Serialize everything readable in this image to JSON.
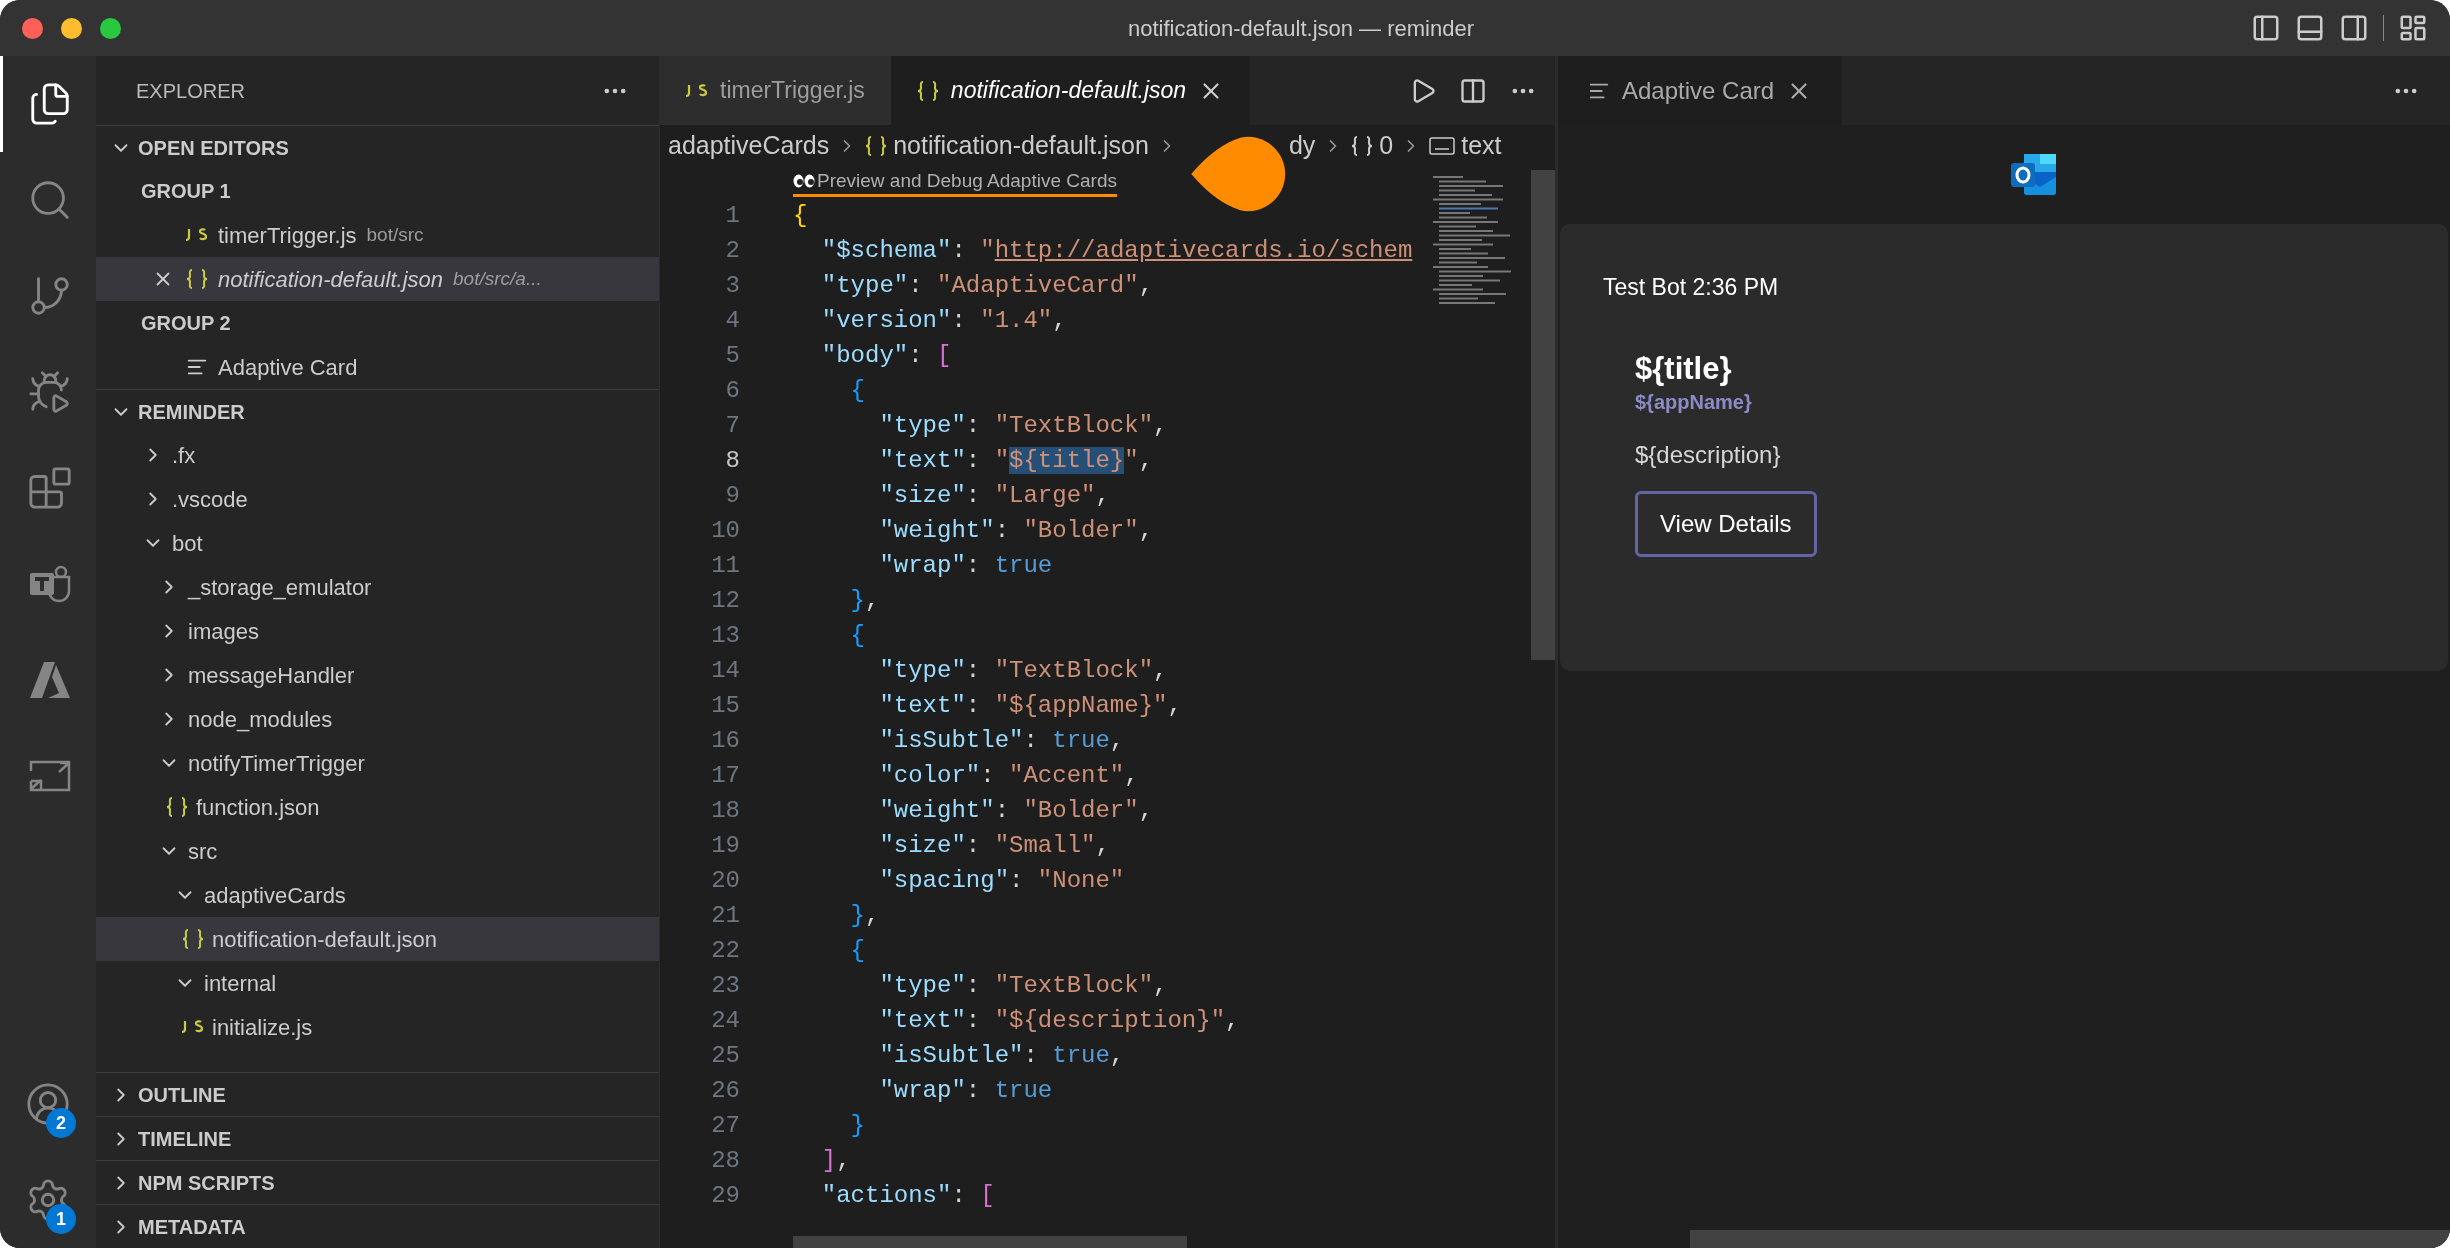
{
  "window": {
    "title": "notification-default.json — reminder"
  },
  "activity_bar": [
    {
      "kind": "explorer",
      "selected": true
    },
    {
      "kind": "search",
      "selected": false
    },
    {
      "kind": "source-control",
      "selected": false
    },
    {
      "kind": "run-debug",
      "selected": false
    },
    {
      "kind": "extensions",
      "selected": false
    },
    {
      "kind": "teams",
      "selected": false
    },
    {
      "kind": "azure",
      "selected": false
    },
    {
      "kind": "remote",
      "selected": false
    }
  ],
  "activity_bar_bottom": [
    {
      "kind": "account",
      "badge": "2"
    },
    {
      "kind": "settings",
      "badge": "1"
    }
  ],
  "sidebar": {
    "title": "EXPLORER",
    "open_editors": {
      "title": "OPEN EDITORS",
      "expanded": true,
      "groups": [
        {
          "title": "GROUP 1",
          "items": [
            {
              "kind": "js",
              "name": "timerTrigger.js",
              "path": "bot/src",
              "selected": false,
              "preview": false
            },
            {
              "kind": "json",
              "name": "notification-default.json",
              "path": "bot/src/a...",
              "selected": true,
              "preview": true
            }
          ]
        },
        {
          "title": "GROUP 2",
          "items": [
            {
              "kind": "preview",
              "name": "Adaptive Card",
              "selected": false,
              "preview": false
            }
          ]
        }
      ]
    },
    "folder": {
      "title": "REMINDER",
      "expanded": true,
      "items": [
        {
          "kind": "folder",
          "name": ".fx",
          "expanded": false,
          "selected": false
        },
        {
          "kind": "folder",
          "name": ".vscode",
          "expanded": false,
          "selected": false
        },
        {
          "kind": "folder",
          "name": "bot",
          "expanded": true,
          "selected": false,
          "children": [
            {
              "kind": "folder",
              "name": "_storage_emulator",
              "expanded": false,
              "selected": false
            },
            {
              "kind": "folder",
              "name": "images",
              "expanded": false,
              "selected": false
            },
            {
              "kind": "folder",
              "name": "messageHandler",
              "expanded": false,
              "selected": false
            },
            {
              "kind": "folder",
              "name": "node_modules",
              "expanded": false,
              "selected": false
            },
            {
              "kind": "folder",
              "name": "notifyTimerTrigger",
              "expanded": true,
              "selected": false,
              "children": [
                {
                  "kind": "json",
                  "name": "function.json",
                  "selected": false
                }
              ]
            },
            {
              "kind": "folder",
              "name": "src",
              "expanded": true,
              "selected": false,
              "children": [
                {
                  "kind": "folder",
                  "name": "adaptiveCards",
                  "expanded": true,
                  "selected": false,
                  "children": [
                    {
                      "kind": "json",
                      "name": "notification-default.json",
                      "selected": true
                    }
                  ]
                },
                {
                  "kind": "folder",
                  "name": "internal",
                  "expanded": true,
                  "selected": false,
                  "children": [
                    {
                      "kind": "js",
                      "name": "initialize.js",
                      "selected": false
                    }
                  ]
                }
              ]
            }
          ]
        }
      ]
    },
    "sections": [
      {
        "title": "OUTLINE",
        "expanded": false
      },
      {
        "title": "TIMELINE",
        "expanded": false
      },
      {
        "title": "NPM SCRIPTS",
        "expanded": false
      },
      {
        "title": "METADATA",
        "expanded": false
      }
    ]
  },
  "editor": {
    "tabs": [
      {
        "kind": "js",
        "label": "timerTrigger.js",
        "selected": false,
        "preview": false
      },
      {
        "kind": "json",
        "label": "notification-default.json",
        "selected": true,
        "preview": true
      }
    ],
    "breadcrumb": [
      {
        "kind": "folder",
        "text": "adaptiveCards"
      },
      {
        "kind": "json",
        "text": "notification-default.json"
      },
      {
        "kind": "plain",
        "text": "dy"
      },
      {
        "kind": "object",
        "text": "0"
      },
      {
        "kind": "string",
        "text": "text"
      }
    ],
    "codelens": "Preview and Debug Adaptive Cards",
    "lines": [
      {
        "number": "1",
        "current": false,
        "tokens": [
          {
            "kind": "b1",
            "text": "{"
          }
        ]
      },
      {
        "number": "2",
        "current": false,
        "tokens": [
          {
            "kind": "key",
            "text": "  \"$schema\""
          },
          {
            "kind": "p",
            "text": ": "
          },
          {
            "kind": "str",
            "text": "\""
          },
          {
            "kind": "link",
            "text": "http://adaptivecards.io/schem"
          }
        ]
      },
      {
        "number": "3",
        "current": false,
        "tokens": [
          {
            "kind": "key",
            "text": "  \"type\""
          },
          {
            "kind": "p",
            "text": ": "
          },
          {
            "kind": "str",
            "text": "\"AdaptiveCard\""
          },
          {
            "kind": "p",
            "text": ","
          }
        ]
      },
      {
        "number": "4",
        "current": false,
        "tokens": [
          {
            "kind": "key",
            "text": "  \"version\""
          },
          {
            "kind": "p",
            "text": ": "
          },
          {
            "kind": "str",
            "text": "\"1.4\""
          },
          {
            "kind": "p",
            "text": ","
          }
        ]
      },
      {
        "number": "5",
        "current": false,
        "tokens": [
          {
            "kind": "key",
            "text": "  \"body\""
          },
          {
            "kind": "p",
            "text": ": "
          },
          {
            "kind": "b2",
            "text": "["
          }
        ]
      },
      {
        "number": "6",
        "current": false,
        "tokens": [
          {
            "kind": "b3",
            "text": "    {"
          }
        ]
      },
      {
        "number": "7",
        "current": false,
        "tokens": [
          {
            "kind": "key",
            "text": "      \"type\""
          },
          {
            "kind": "p",
            "text": ": "
          },
          {
            "kind": "str",
            "text": "\"TextBlock\""
          },
          {
            "kind": "p",
            "text": ","
          }
        ]
      },
      {
        "number": "8",
        "current": true,
        "tokens": [
          {
            "kind": "key",
            "text": "      \"text\""
          },
          {
            "kind": "p",
            "text": ": "
          },
          {
            "kind": "str",
            "text": "\""
          },
          {
            "kind": "sel",
            "text": "${title}"
          },
          {
            "kind": "str",
            "text": "\""
          },
          {
            "kind": "p",
            "text": ","
          }
        ]
      },
      {
        "number": "9",
        "current": false,
        "tokens": [
          {
            "kind": "key",
            "text": "      \"size\""
          },
          {
            "kind": "p",
            "text": ": "
          },
          {
            "kind": "str",
            "text": "\"Large\""
          },
          {
            "kind": "p",
            "text": ","
          }
        ]
      },
      {
        "number": "10",
        "current": false,
        "tokens": [
          {
            "kind": "key",
            "text": "      \"weight\""
          },
          {
            "kind": "p",
            "text": ": "
          },
          {
            "kind": "str",
            "text": "\"Bolder\""
          },
          {
            "kind": "p",
            "text": ","
          }
        ]
      },
      {
        "number": "11",
        "current": false,
        "tokens": [
          {
            "kind": "key",
            "text": "      \"wrap\""
          },
          {
            "kind": "p",
            "text": ": "
          },
          {
            "kind": "bool",
            "text": "true"
          }
        ]
      },
      {
        "number": "12",
        "current": false,
        "tokens": [
          {
            "kind": "b3",
            "text": "    }"
          },
          {
            "kind": "p",
            "text": ","
          }
        ]
      },
      {
        "number": "13",
        "current": false,
        "tokens": [
          {
            "kind": "b3",
            "text": "    {"
          }
        ]
      },
      {
        "number": "14",
        "current": false,
        "tokens": [
          {
            "kind": "key",
            "text": "      \"type\""
          },
          {
            "kind": "p",
            "text": ": "
          },
          {
            "kind": "str",
            "text": "\"TextBlock\""
          },
          {
            "kind": "p",
            "text": ","
          }
        ]
      },
      {
        "number": "15",
        "current": false,
        "tokens": [
          {
            "kind": "key",
            "text": "      \"text\""
          },
          {
            "kind": "p",
            "text": ": "
          },
          {
            "kind": "str",
            "text": "\"${appName}\""
          },
          {
            "kind": "p",
            "text": ","
          }
        ]
      },
      {
        "number": "16",
        "current": false,
        "tokens": [
          {
            "kind": "key",
            "text": "      \"isSubtle\""
          },
          {
            "kind": "p",
            "text": ": "
          },
          {
            "kind": "bool",
            "text": "true"
          },
          {
            "kind": "p",
            "text": ","
          }
        ]
      },
      {
        "number": "17",
        "current": false,
        "tokens": [
          {
            "kind": "key",
            "text": "      \"color\""
          },
          {
            "kind": "p",
            "text": ": "
          },
          {
            "kind": "str",
            "text": "\"Accent\""
          },
          {
            "kind": "p",
            "text": ","
          }
        ]
      },
      {
        "number": "18",
        "current": false,
        "tokens": [
          {
            "kind": "key",
            "text": "      \"weight\""
          },
          {
            "kind": "p",
            "text": ": "
          },
          {
            "kind": "str",
            "text": "\"Bolder\""
          },
          {
            "kind": "p",
            "text": ","
          }
        ]
      },
      {
        "number": "19",
        "current": false,
        "tokens": [
          {
            "kind": "key",
            "text": "      \"size\""
          },
          {
            "kind": "p",
            "text": ": "
          },
          {
            "kind": "str",
            "text": "\"Small\""
          },
          {
            "kind": "p",
            "text": ","
          }
        ]
      },
      {
        "number": "20",
        "current": false,
        "tokens": [
          {
            "kind": "key",
            "text": "      \"spacing\""
          },
          {
            "kind": "p",
            "text": ": "
          },
          {
            "kind": "str",
            "text": "\"None\""
          }
        ]
      },
      {
        "number": "21",
        "current": false,
        "tokens": [
          {
            "kind": "b3",
            "text": "    }"
          },
          {
            "kind": "p",
            "text": ","
          }
        ]
      },
      {
        "number": "22",
        "current": false,
        "tokens": [
          {
            "kind": "b3",
            "text": "    {"
          }
        ]
      },
      {
        "number": "23",
        "current": false,
        "tokens": [
          {
            "kind": "key",
            "text": "      \"type\""
          },
          {
            "kind": "p",
            "text": ": "
          },
          {
            "kind": "str",
            "text": "\"TextBlock\""
          },
          {
            "kind": "p",
            "text": ","
          }
        ]
      },
      {
        "number": "24",
        "current": false,
        "tokens": [
          {
            "kind": "key",
            "text": "      \"text\""
          },
          {
            "kind": "p",
            "text": ": "
          },
          {
            "kind": "str",
            "text": "\"${description}\""
          },
          {
            "kind": "p",
            "text": ","
          }
        ]
      },
      {
        "number": "25",
        "current": false,
        "tokens": [
          {
            "kind": "key",
            "text": "      \"isSubtle\""
          },
          {
            "kind": "p",
            "text": ": "
          },
          {
            "kind": "bool",
            "text": "true"
          },
          {
            "kind": "p",
            "text": ","
          }
        ]
      },
      {
        "number": "26",
        "current": false,
        "tokens": [
          {
            "kind": "key",
            "text": "      \"wrap\""
          },
          {
            "kind": "p",
            "text": ": "
          },
          {
            "kind": "bool",
            "text": "true"
          }
        ]
      },
      {
        "number": "27",
        "current": false,
        "tokens": [
          {
            "kind": "b3",
            "text": "    }"
          }
        ]
      },
      {
        "number": "28",
        "current": false,
        "tokens": [
          {
            "kind": "b2",
            "text": "  ]"
          },
          {
            "kind": "p",
            "text": ","
          }
        ]
      },
      {
        "number": "29",
        "current": false,
        "tokens": [
          {
            "kind": "key",
            "text": "  \"actions\""
          },
          {
            "kind": "p",
            "text": ": "
          },
          {
            "kind": "b2",
            "text": "["
          }
        ]
      }
    ]
  },
  "preview_panel": {
    "tab": {
      "label": "Adaptive Card",
      "selected": true
    },
    "card": {
      "header": "Test Bot 2:36 PM",
      "title": "${title}",
      "subtitle": "${appName}",
      "description": "${description}",
      "action": "View Details"
    }
  }
}
